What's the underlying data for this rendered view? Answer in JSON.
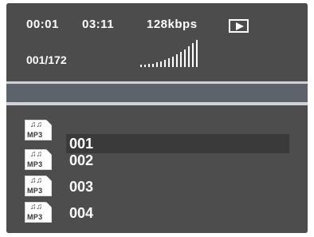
{
  "status": {
    "elapsed": "00:01",
    "total": "03:11",
    "bitrate": "128kbps",
    "track_counter": "001/172",
    "play_state_icon": "play-icon",
    "volume_level": 0.75
  },
  "playlist": {
    "icon_label": "MP3",
    "items": [
      {
        "name": "001",
        "selected": true
      },
      {
        "name": "002",
        "selected": false
      },
      {
        "name": "003",
        "selected": false
      },
      {
        "name": "004",
        "selected": false
      }
    ]
  },
  "colors": {
    "panel": "#4c4c4c",
    "selection": "#3a3a3a",
    "separator": "#cfd3d7",
    "band": "#5c636b",
    "text": "#ffffff"
  }
}
